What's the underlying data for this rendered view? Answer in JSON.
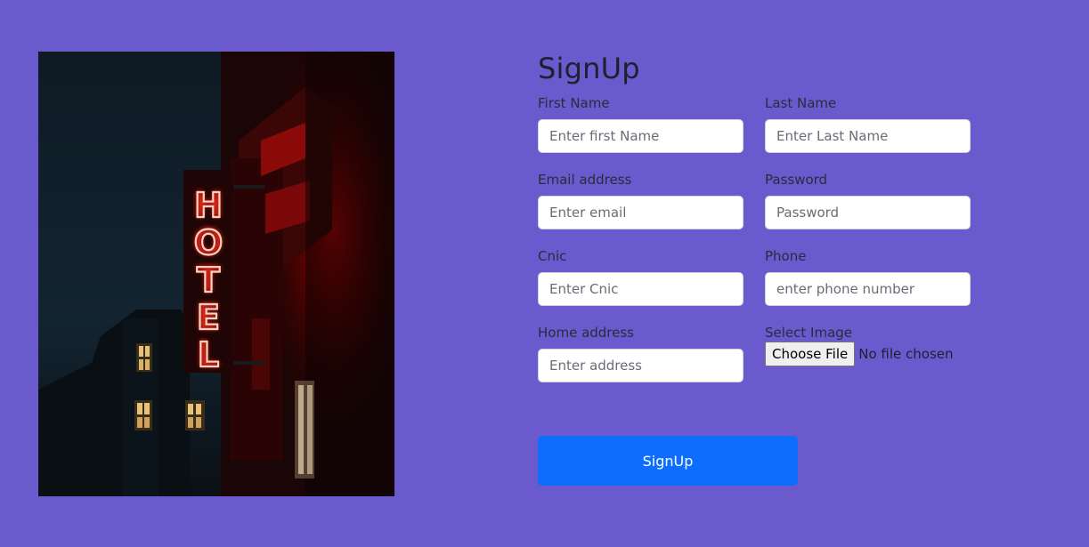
{
  "form": {
    "title": "SignUp",
    "fields": {
      "first_name": {
        "label": "First Name",
        "placeholder": "Enter first Name"
      },
      "last_name": {
        "label": "Last Name",
        "placeholder": "Enter Last Name"
      },
      "email": {
        "label": "Email address",
        "placeholder": "Enter email"
      },
      "password": {
        "label": "Password",
        "placeholder": "Password"
      },
      "cnic": {
        "label": "Cnic",
        "placeholder": "Enter Cnic"
      },
      "phone": {
        "label": "Phone",
        "placeholder": "enter phone number"
      },
      "home_address": {
        "label": "Home address",
        "placeholder": "Enter address"
      },
      "image": {
        "label": "Select Image",
        "button_label": "Choose File",
        "status": "No file chosen"
      }
    },
    "submit_label": "SignUp"
  },
  "hero": {
    "sign_letters": [
      "H",
      "O",
      "T",
      "E",
      "L"
    ]
  },
  "colors": {
    "page_bg": "#6a5acd",
    "primary": "#0d6efd",
    "neon": "#ff2a1a"
  }
}
